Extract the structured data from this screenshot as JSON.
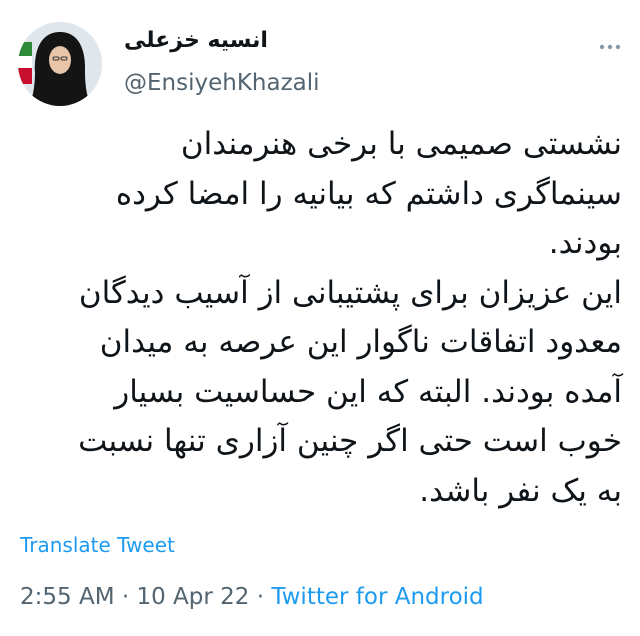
{
  "author": {
    "display_name": "انسیه خزعلی",
    "handle": "@EnsiyehKhazali",
    "avatar_icon": "profile-photo-woman-in-black-chador-with-iran-flag"
  },
  "more_icon": "more-options-icon",
  "tweet": {
    "text": "نشستی صمیمی با برخی هنرمندان\nسینماگری داشتم که بیانیه را امضا کرده\nبودند.\nاین عزیزان برای پشتیبانی از آسیب دیدگان\nمعدود اتفاقات ناگوار این عرصه به میدان\nآمده بودند. البته که این حساسیت بسیار\nخوب است حتی اگر چنین آزاری تنها نسبت\nبه یک نفر باشد."
  },
  "translate_label": "Translate Tweet",
  "meta": {
    "time": "2:55 AM",
    "separator": "·",
    "date": "10 Apr 22",
    "source": "Twitter for Android"
  },
  "colors": {
    "link": "#1d9bf0",
    "secondary": "#536471",
    "text": "#0f1419"
  }
}
